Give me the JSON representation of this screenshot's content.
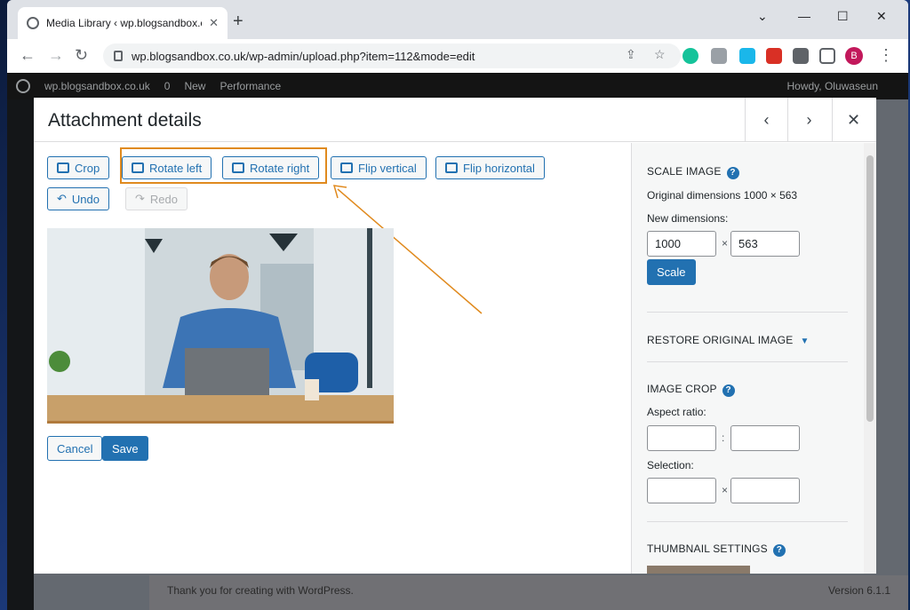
{
  "browser": {
    "tab_title": "Media Library ‹ wp.blogsandbox.co.uk",
    "url": "wp.blogsandbox.co.uk/wp-admin/upload.php?item=112&mode=edit",
    "avatar_initial": "B"
  },
  "adminbar": {
    "site": "wp.blogsandbox.co.uk",
    "comments": "0",
    "new": "New",
    "performance": "Performance",
    "howdy": "Howdy, Oluwaseun"
  },
  "modal": {
    "title": "Attachment details"
  },
  "toolbar": {
    "crop": "Crop",
    "rotate_left": "Rotate left",
    "rotate_right": "Rotate right",
    "flip_vertical": "Flip vertical",
    "flip_horizontal": "Flip horizontal",
    "undo": "Undo",
    "redo": "Redo"
  },
  "actions": {
    "cancel": "Cancel",
    "save": "Save"
  },
  "scale": {
    "heading": "SCALE IMAGE",
    "original": "Original dimensions 1000 × 563",
    "new_label": "New dimensions:",
    "width": "1000",
    "height": "563",
    "sep": "×",
    "button": "Scale"
  },
  "restore": {
    "heading": "RESTORE ORIGINAL IMAGE"
  },
  "crop": {
    "heading": "IMAGE CROP",
    "aspect_label": "Aspect ratio:",
    "aspect_sep": ":",
    "selection_label": "Selection:",
    "selection_sep": "×"
  },
  "thumbnail": {
    "heading": "THUMBNAIL SETTINGS"
  },
  "footer": {
    "text": "Thank you for creating with WordPress.",
    "version": "Version 6.1.1"
  },
  "colors": {
    "accent": "#2271b1",
    "highlight": "#e08a1e"
  }
}
